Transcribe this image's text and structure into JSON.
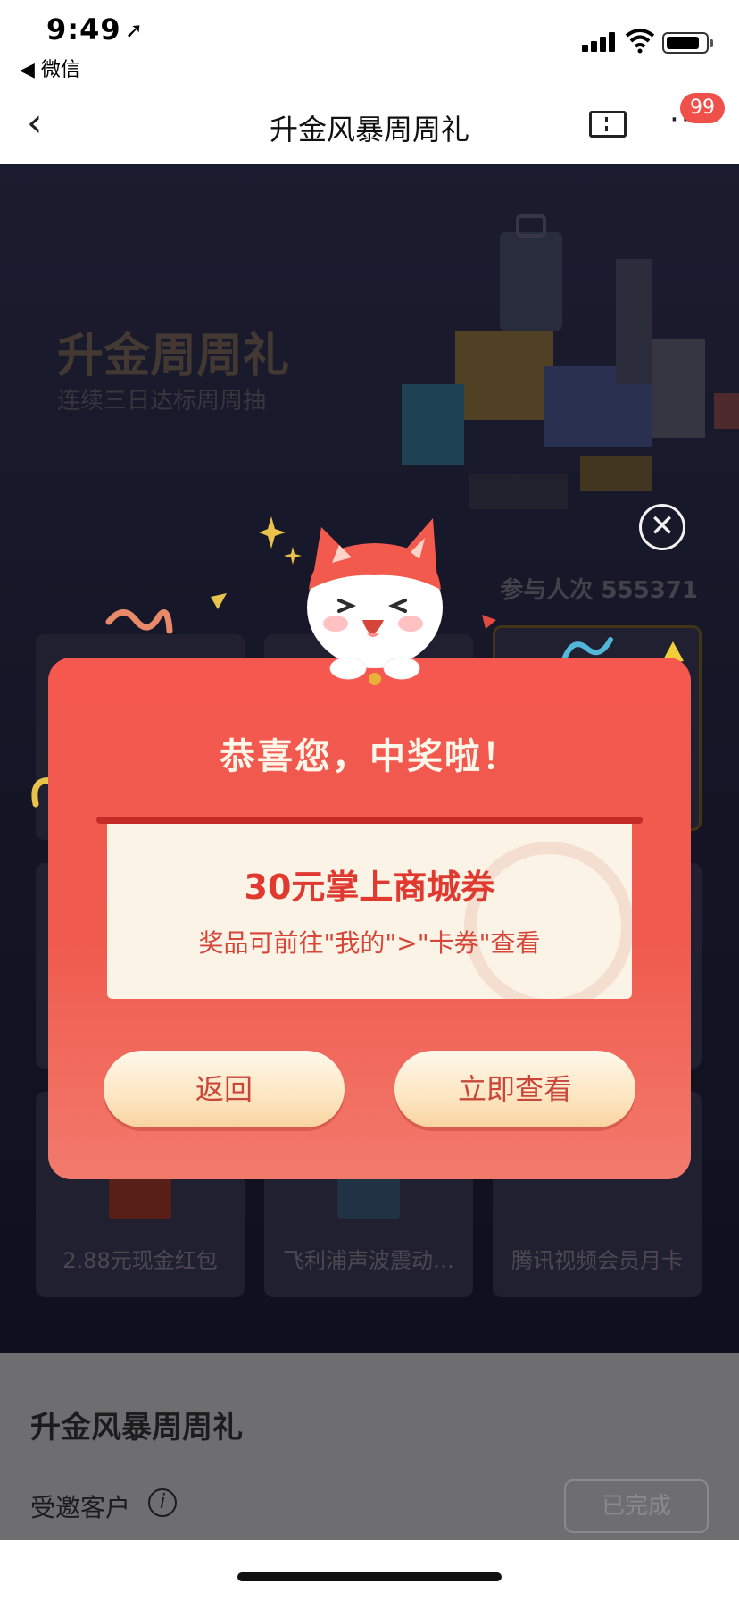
{
  "status_bar": {
    "time": "9:49",
    "back_to_app": "◀ 微信"
  },
  "nav": {
    "title": "升金风暴周周礼",
    "badge_count": "99",
    "icons": [
      "back-chevron-icon",
      "ticket-icon",
      "more-icon"
    ]
  },
  "hero": {
    "title": "升金周周礼",
    "subtitle": "连续三日达标周周抽",
    "participants": "参与人次 555371"
  },
  "tiles": {
    "bottom": [
      {
        "label": "2.88元现金红包"
      },
      {
        "label": "飞利浦声波震动…"
      },
      {
        "label": "腾讯视频会员月卡"
      }
    ]
  },
  "popup": {
    "title": "恭喜您，中奖啦！",
    "prize": "30元掌上商城券",
    "hint": "奖品可前往\"我的\">\"卡券\"查看",
    "back_label": "返回",
    "view_label": "立即查看",
    "close_symbol": "✕"
  },
  "section": {
    "title": "升金风暴周周礼",
    "invited_label": "受邀客户",
    "info_symbol": "i",
    "status_button": "已完成"
  },
  "colors": {
    "popup_red": "#f4584e",
    "button_gold": "#fde6c2",
    "prize_text": "#e03a30"
  }
}
